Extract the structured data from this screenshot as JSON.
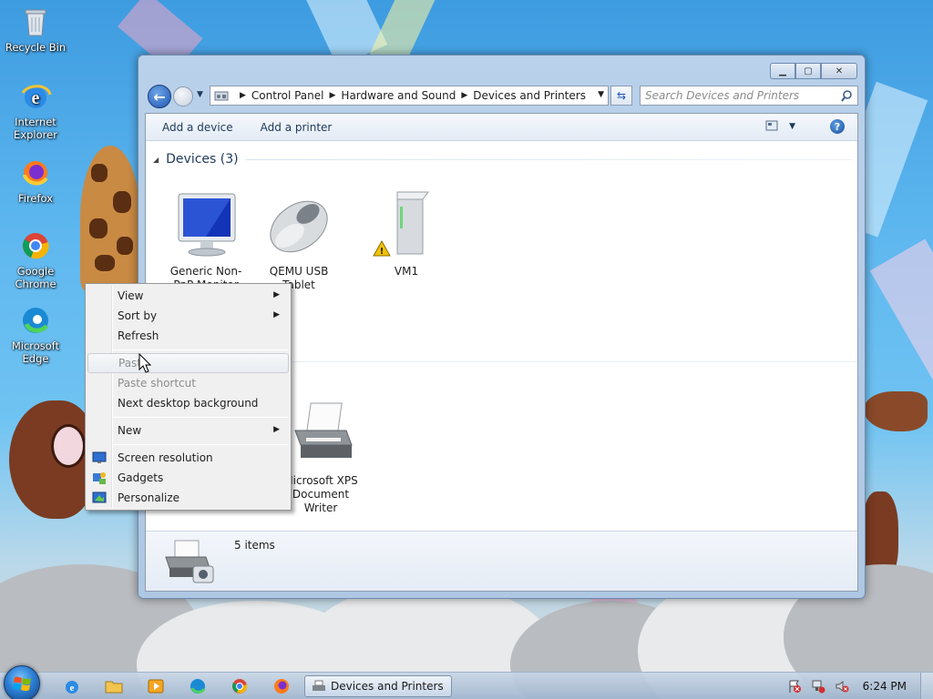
{
  "desktop": {
    "icons": [
      {
        "label": "Recycle Bin"
      },
      {
        "label": "Internet Explorer"
      },
      {
        "label": "Firefox"
      },
      {
        "label": "Google Chrome"
      },
      {
        "label": "Microsoft Edge"
      }
    ]
  },
  "window": {
    "breadcrumbs": [
      "Control Panel",
      "Hardware and Sound",
      "Devices and Printers"
    ],
    "search_placeholder": "Search Devices and Printers",
    "toolbar": {
      "add_device": "Add a device",
      "add_printer": "Add a printer"
    },
    "groups": {
      "devices_header": "Devices (3)"
    },
    "devices": [
      {
        "name": "Generic Non-PnP Monitor",
        "icon": "monitor-icon"
      },
      {
        "name": "QEMU USB Tablet",
        "icon": "mouse-icon"
      },
      {
        "name": "VM1",
        "icon": "computer-icon"
      }
    ],
    "printers": [
      {
        "name": "Microsoft XPS Document Writer",
        "icon": "printer-icon"
      }
    ],
    "details": {
      "item_count": "5 items"
    },
    "caption_buttons": {
      "min": "▁",
      "max": "▢",
      "close": "✕"
    }
  },
  "context_menu": {
    "items": [
      {
        "label": "View",
        "submenu": true
      },
      {
        "label": "Sort by",
        "submenu": true
      },
      {
        "label": "Refresh"
      },
      {
        "label": "Paste",
        "disabled": true
      },
      {
        "label": "Paste shortcut",
        "disabled": true
      },
      {
        "label": "Next desktop background"
      },
      {
        "label": "New",
        "submenu": true
      },
      {
        "label": "Screen resolution",
        "icon": "screen-resolution-icon"
      },
      {
        "label": "Gadgets",
        "icon": "gadgets-icon"
      },
      {
        "label": "Personalize",
        "icon": "personalize-icon"
      }
    ]
  },
  "taskbar": {
    "active_task": "Devices and Printers",
    "clock": "6:24 PM"
  },
  "colors": {
    "accent": "#1e395b",
    "window_frame": "#b9d1ea"
  }
}
